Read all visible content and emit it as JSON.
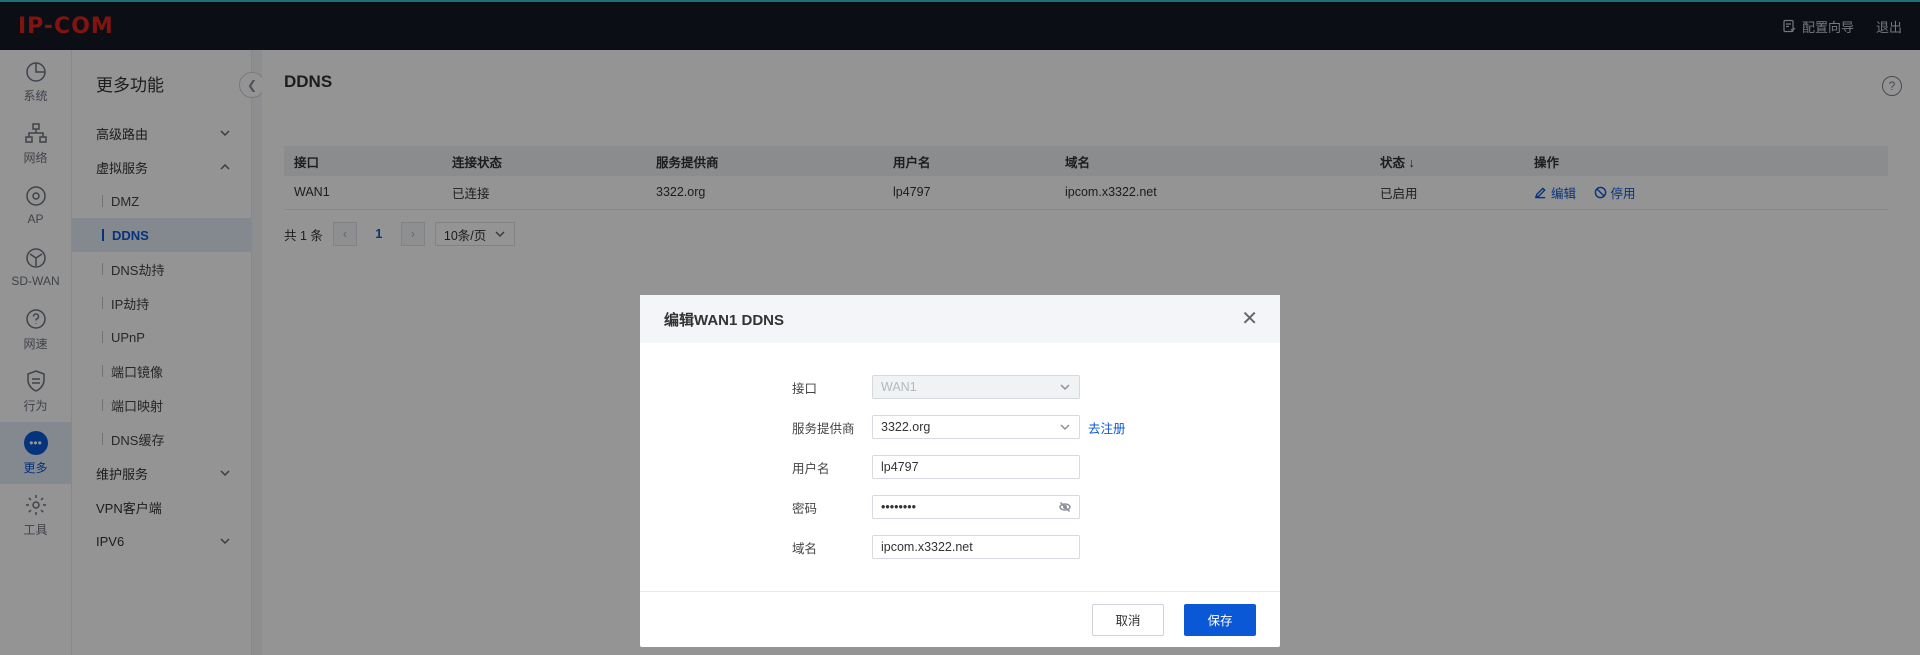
{
  "header": {
    "logo": "IP-COM",
    "wizard_label": "配置向导",
    "logout_label": "退出"
  },
  "iconnav": [
    {
      "label": "系统",
      "icon": "pie-chart-icon"
    },
    {
      "label": "网络",
      "icon": "network-icon"
    },
    {
      "label": "AP",
      "icon": "ap-icon"
    },
    {
      "label": "SD-WAN",
      "icon": "sdwan-icon"
    },
    {
      "label": "网速",
      "icon": "speed-icon"
    },
    {
      "label": "行为",
      "icon": "shield-icon"
    },
    {
      "label": "更多",
      "icon": "more-icon",
      "active": true
    },
    {
      "label": "工具",
      "icon": "gear-icon"
    }
  ],
  "submenu": {
    "title": "更多功能",
    "groups": [
      {
        "label": "高级路由"
      },
      {
        "label": "虚拟服务",
        "expanded": true,
        "items": [
          "DMZ",
          "DDNS",
          "DNS劫持",
          "IP劫持",
          "UPnP",
          "端口镜像",
          "端口映射",
          "DNS缓存"
        ],
        "active_item": "DDNS"
      },
      {
        "label": "维护服务"
      },
      {
        "label": "VPN客户端"
      },
      {
        "label": "IPV6"
      }
    ]
  },
  "page": {
    "title": "DDNS",
    "table": {
      "columns": [
        "接口",
        "连接状态",
        "服务提供商",
        "用户名",
        "域名",
        "状态",
        "操作"
      ],
      "rows": [
        {
          "interface": "WAN1",
          "conn_status": "已连接",
          "provider": "3322.org",
          "username": "lp4797",
          "domain": "ipcom.x3322.net",
          "status": "已启用",
          "edit": "编辑",
          "disable": "停用"
        }
      ]
    },
    "pager": {
      "total": "共 1 条",
      "current": "1",
      "page_size": "10条/页"
    }
  },
  "modal": {
    "title": "编辑WAN1 DDNS",
    "fields": {
      "interface_label": "接口",
      "interface_value": "WAN1",
      "provider_label": "服务提供商",
      "provider_value": "3322.org",
      "register_link": "去注册",
      "username_label": "用户名",
      "username_value": "lp4797",
      "password_label": "密码",
      "password_value": "••••••••",
      "domain_label": "域名",
      "domain_value": "ipcom.x3322.net"
    },
    "cancel_label": "取消",
    "save_label": "保存"
  },
  "colors": {
    "accent": "#0a58d6",
    "success": "#2d9a3f",
    "topbar": "#141923",
    "logo": "#e1241b"
  }
}
